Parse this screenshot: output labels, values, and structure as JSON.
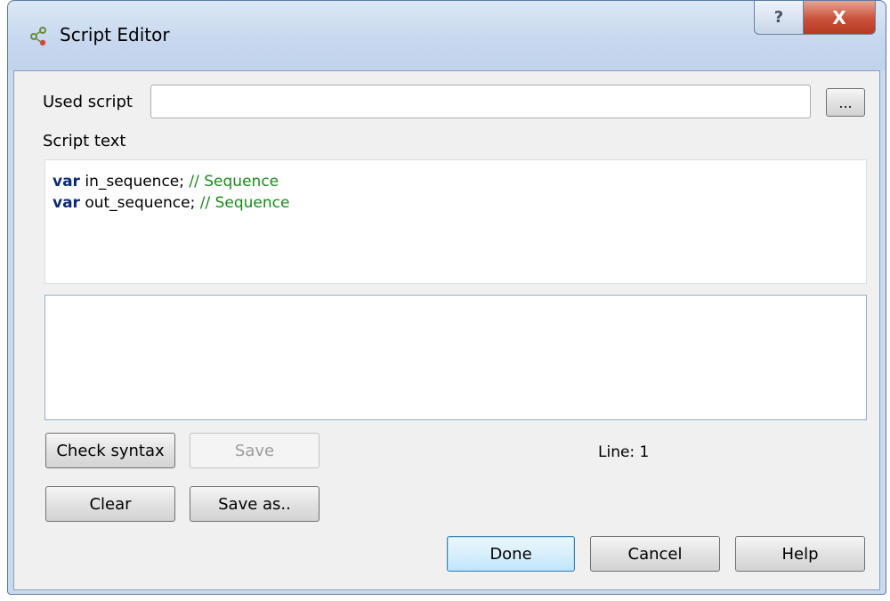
{
  "window": {
    "title": "Script Editor",
    "title_icon": "script-nodes-icon",
    "help_glyph": "?",
    "close_glyph": "X"
  },
  "form": {
    "used_script_label": "Used script",
    "used_script_value": "",
    "browse_label": "...",
    "script_text_label": "Script text"
  },
  "editor": {
    "lines": [
      {
        "keyword": "var",
        "identifier": "in_sequence;",
        "comment": "// Sequence"
      },
      {
        "keyword": "var",
        "identifier": "out_sequence;",
        "comment": "// Sequence"
      }
    ]
  },
  "output": {
    "text": ""
  },
  "buttons": {
    "check_syntax": "Check syntax",
    "save": "Save",
    "clear": "Clear",
    "save_as": "Save as..",
    "done": "Done",
    "cancel": "Cancel",
    "help": "Help"
  },
  "status": {
    "line": "Line: 1"
  },
  "colors": {
    "keyword": "#0a2a7a",
    "comment": "#1a8a1a",
    "close_button": "#c9513a"
  }
}
